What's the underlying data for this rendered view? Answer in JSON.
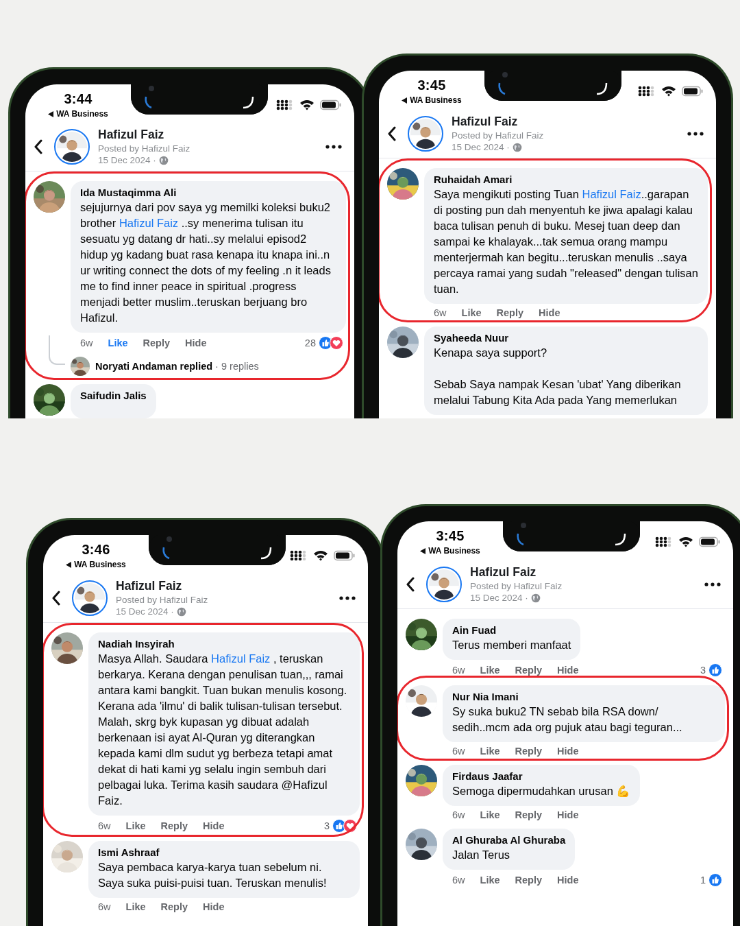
{
  "phones": [
    {
      "time": "3:44",
      "back_app": "WA Business",
      "post": {
        "author": "Hafizul Faiz",
        "posted_by": "Posted by Hafizul Faiz",
        "date": "15 Dec 2024 ·"
      },
      "comments": [
        {
          "name": "Ida Mustaqimma Ali",
          "text": [
            {
              "text": "sejujurnya dari pov saya yg memilki koleksi buku2 brother "
            },
            {
              "link": "Hafizul Faiz"
            },
            {
              "text": " ..sy menerima tulisan itu sesuatu yg datang dr hati..sy melalui episod2 hidup yg kadang buat rasa kenapa itu knapa ini..n ur writing connect the dots of my feeling .n it leads me to find inner peace in spiritual .progress menjadi better muslim..teruskan berjuang bro Hafizul."
            }
          ],
          "highlighted": true,
          "age": "6w",
          "actions": [
            "Like",
            "Reply",
            "Hide"
          ],
          "liked": true,
          "reaction_count": "28",
          "reactions": [
            {
              "kind": "like"
            },
            {
              "kind": "heart"
            }
          ],
          "reply_summary": "**Noryati Andaman replied** · 9 replies"
        },
        {
          "name": "Saifudin Jalis",
          "highlighted": false
        }
      ]
    },
    {
      "time": "3:45",
      "back_app": "WA Business",
      "post": {
        "author": "Hafizul Faiz",
        "posted_by": "Posted by Hafizul Faiz",
        "date": "15 Dec 2024 ·"
      },
      "comments": [
        {
          "name": "Ruhaidah Amari",
          "text": [
            {
              "text": "Saya mengikuti posting Tuan "
            },
            {
              "link": "Hafizul Faiz"
            },
            {
              "text": "..garapan di posting pun dah menyentuh ke jiwa apalagi kalau baca tulisan penuh di buku. Mesej tuan deep dan sampai ke khalayak...tak semua orang mampu menterjermah kan begitu...teruskan menulis ..saya percaya ramai yang sudah \"released\" dengan tulisan tuan."
            }
          ],
          "highlighted": true,
          "age": "6w",
          "actions": [
            "Like",
            "Reply",
            "Hide"
          ],
          "liked": false
        },
        {
          "name": "Syaheeda Nuur",
          "text": [
            {
              "text": "Kenapa saya support?\n\nSebab Saya nampak Kesan 'ubat' Yang diberikan melalui Tabung Kita Ada pada Yang memerlukan"
            }
          ],
          "highlighted": false
        }
      ]
    },
    {
      "time": "3:46",
      "back_app": "WA Business",
      "post": {
        "author": "Hafizul Faiz",
        "posted_by": "Posted by Hafizul Faiz",
        "date": "15 Dec 2024 ·"
      },
      "comments": [
        {
          "name": "Nadiah Insyirah",
          "text": [
            {
              "text": "Masya Allah. Saudara "
            },
            {
              "link": "Hafizul Faiz"
            },
            {
              "text": " , teruskan berkarya. Kerana dengan penulisan tuan,,, ramai antara kami bangkit. Tuan bukan menulis kosong. Kerana ada 'ilmu' di balik tulisan-tulisan tersebut. Malah, skrg byk kupasan yg dibuat adalah berkenaan isi ayat Al-Quran yg diterangkan kepada kami dlm sudut yg berbeza tetapi amat dekat di hati kami yg selalu ingin sembuh dari pelbagai luka. Terima kasih saudara @Hafizul Faiz."
            }
          ],
          "highlighted": true,
          "age": "6w",
          "actions": [
            "Like",
            "Reply",
            "Hide"
          ],
          "liked": false,
          "reaction_count": "3",
          "reactions": [
            {
              "kind": "like"
            },
            {
              "kind": "heart"
            }
          ]
        },
        {
          "name": "Ismi Ashraaf",
          "text": [
            {
              "text": "Saya pembaca karya-karya tuan sebelum ni. Saya suka puisi-puisi tuan. Teruskan menulis!"
            }
          ],
          "highlighted": false,
          "age": "6w",
          "actions": [
            "Like",
            "Reply",
            "Hide"
          ],
          "liked": false
        }
      ]
    },
    {
      "time": "3:45",
      "back_app": "WA Business",
      "post": {
        "author": "Hafizul Faiz",
        "posted_by": "Posted by Hafizul Faiz",
        "date": "15 Dec 2024 ·"
      },
      "comments": [
        {
          "name": "Ain Fuad",
          "text": [
            {
              "text": "Terus memberi manfaat"
            }
          ],
          "highlighted": false,
          "age": "6w",
          "actions": [
            "Like",
            "Reply",
            "Hide"
          ],
          "liked": false,
          "reaction_count": "3",
          "reactions": [
            {
              "kind": "like"
            }
          ]
        },
        {
          "name": "Nur Nia Imani",
          "text": [
            {
              "text": "Sy suka buku2 TN sebab bila RSA down/ sedih..mcm ada org pujuk atau bagi teguran..."
            }
          ],
          "highlighted": true,
          "age": "6w",
          "actions": [
            "Like",
            "Reply",
            "Hide"
          ],
          "liked": false
        },
        {
          "name": "Firdaus Jaafar",
          "text": [
            {
              "text": "Semoga dipermudahkan urusan 💪"
            }
          ],
          "highlighted": false,
          "age": "6w",
          "actions": [
            "Like",
            "Reply",
            "Hide"
          ],
          "liked": false
        },
        {
          "name": "Al Ghuraba Al Ghuraba",
          "text": [
            {
              "text": "Jalan Terus"
            }
          ],
          "highlighted": false,
          "age": "6w",
          "actions": [
            "Like",
            "Reply",
            "Hide"
          ],
          "liked": false,
          "reaction_count": "1",
          "reactions": [
            {
              "kind": "like"
            }
          ]
        }
      ]
    }
  ]
}
